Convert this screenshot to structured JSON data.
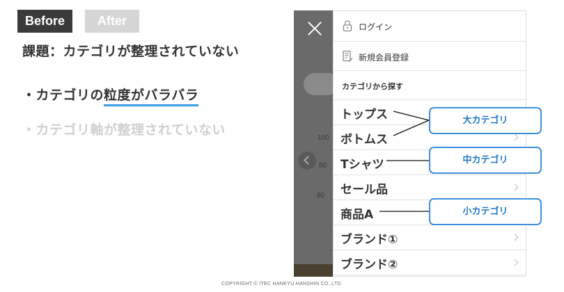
{
  "tabs": {
    "before": "Before",
    "after": "After"
  },
  "issue_title": "課題：カテゴリが整理されていない",
  "points": [
    {
      "prefix": "・カテゴリの",
      "highlight": "粒度がバラバラ"
    },
    {
      "text": "・カテゴリ軸が整理されていない"
    }
  ],
  "menu": {
    "login": "ログイン",
    "register": "新規会員登録",
    "section": "カテゴリから探す",
    "categories": [
      {
        "label": "トップス",
        "chevron": false
      },
      {
        "label": "ボトムス",
        "chevron": true
      },
      {
        "label": "Tシャツ",
        "chevron": false
      },
      {
        "label": "セール品",
        "chevron": true
      },
      {
        "label": "商品A",
        "chevron": false
      },
      {
        "label": "ブランド①",
        "chevron": true
      },
      {
        "label": "ブランド②",
        "chevron": true
      }
    ]
  },
  "backdrop_ticks": [
    "100",
    "80",
    "60"
  ],
  "callouts": {
    "large": "大カテゴリ",
    "medium": "中カテゴリ",
    "small": "小カテゴリ"
  },
  "copyright": "COPYRIGHT © ITEC HANKYU HANSHIN CO.,LTD.",
  "colors": {
    "accent": "#3b8fd9",
    "tab_active": "#3a3a3a",
    "tab_inactive": "#d6d6d6"
  }
}
